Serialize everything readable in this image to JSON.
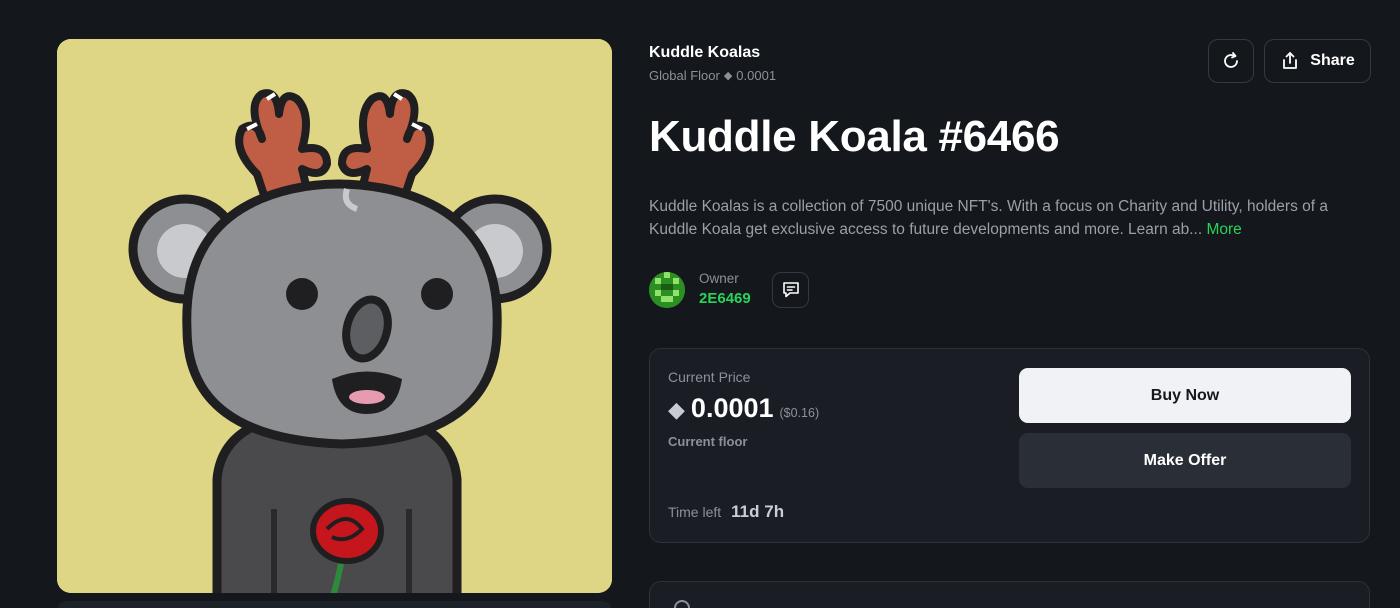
{
  "artwork": {
    "alt": "Kuddle Koala artwork",
    "background_color": "#dfd685"
  },
  "header": {
    "collection_name": "Kuddle Koalas",
    "floor_label": "Global Floor",
    "floor_value": "0.0001",
    "refresh_icon": "refresh-icon",
    "share_label": "Share",
    "share_icon": "share-icon"
  },
  "title": "Kuddle Koala #6466",
  "description": {
    "text": "Kuddle Koalas is a collection of 7500 unique NFT's. With a focus on Charity and Utility, holders of a Kuddle Koala get exclusive access to future developments and more. Learn ab...",
    "more_label": "More"
  },
  "owner": {
    "label": "Owner",
    "name": "2E6469",
    "message_icon": "message-icon"
  },
  "price_card": {
    "current_price_label": "Current Price",
    "price": "0.0001",
    "usd": "($0.16)",
    "floor_label": "Current floor",
    "time_left_label": "Time left",
    "time_left_value": "11d 7h",
    "buy_label": "Buy Now",
    "offer_label": "Make Offer"
  },
  "colors": {
    "background": "#14171c",
    "card": "#1a1d23",
    "accent_green": "#29d35a",
    "muted_text": "#8b919b"
  }
}
